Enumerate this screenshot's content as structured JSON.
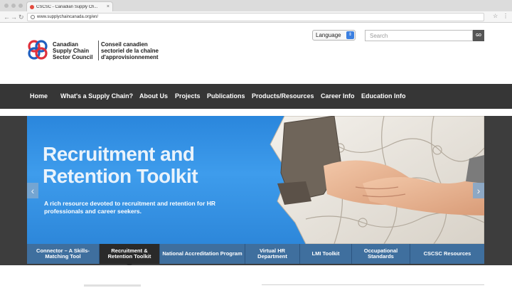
{
  "browser": {
    "tab_title": "CSCSC - Canadian Supply Ch...",
    "tab_close": "×",
    "url": "www.supplychaincanada.org/en/",
    "back": "←",
    "forward": "→",
    "reload": "↻",
    "star": "☆",
    "menu": "⋮"
  },
  "header": {
    "logo_en": "Canadian Supply Chain Sector Council",
    "logo_fr": "Conseil canadien sectoriel de la chaîne d'approvisionnement",
    "language_label": "Language",
    "search_placeholder": "Search",
    "go_label": "GO"
  },
  "nav": {
    "items": [
      "Home",
      "What's a Supply Chain?",
      "About Us",
      "Projects",
      "Publications",
      "Products/Resources",
      "Career Info",
      "Education Info"
    ]
  },
  "hero": {
    "title": "Recruitment and Retention Toolkit",
    "description": "A rich resource devoted to recruitment and retention for HR professionals and career seekers.",
    "prev": "‹",
    "next": "›"
  },
  "slider_tabs": [
    {
      "label": "Connector – A Skills-Matching Tool",
      "active": false
    },
    {
      "label": "Recruitment & Retention Toolkit",
      "active": true
    },
    {
      "label": "National Accreditation Program",
      "active": false
    },
    {
      "label": "Virtual HR Department",
      "active": false
    },
    {
      "label": "LMI Toolkit",
      "active": false
    },
    {
      "label": "Occupational Standards",
      "active": false
    },
    {
      "label": "CSCSC Resources",
      "active": false
    }
  ],
  "colors": {
    "nav_bg": "#363636",
    "hero_blue": "#2d87da",
    "tab_blue": "#3f6f9e",
    "tab_active": "#2a2a2a",
    "logo_red": "#e0303b",
    "logo_blue": "#1f5fbf"
  }
}
